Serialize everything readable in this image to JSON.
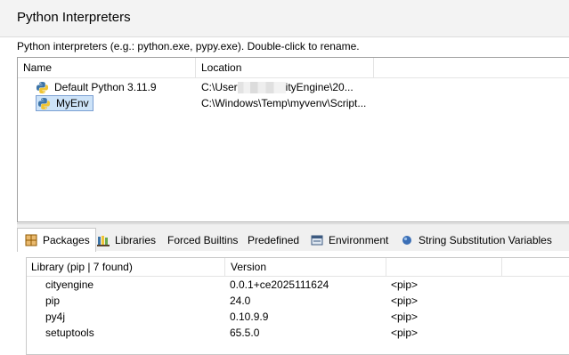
{
  "header": {
    "title": "Python Interpreters",
    "description": "Python interpreters (e.g.: python.exe, pypy.exe).   Double-click to rename."
  },
  "interpreters": {
    "columns": [
      "Name",
      "Location"
    ],
    "rows": [
      {
        "name": "Default Python 3.11.9",
        "location_prefix": "C:\\User",
        "location_suffix": "ityEngine\\20...",
        "icon": "python-icon",
        "selected": false
      },
      {
        "name": "MyEnv",
        "location": "C:\\Windows\\Temp\\myvenv\\Script...",
        "icon": "python-icon",
        "selected": true
      }
    ]
  },
  "tabs": [
    {
      "label": "Packages",
      "icon": "packages-icon",
      "active": true
    },
    {
      "label": "Libraries",
      "icon": "libraries-icon",
      "active": false
    },
    {
      "label": "Forced Builtins",
      "active": false
    },
    {
      "label": "Predefined",
      "active": false
    },
    {
      "label": "Environment",
      "icon": "environment-icon",
      "active": false
    },
    {
      "label": "String Substitution Variables",
      "icon": "variables-icon",
      "active": false
    }
  ],
  "packages": {
    "columns": [
      "Library (pip | 7 found)",
      "Version"
    ],
    "rows": [
      {
        "library": "cityengine",
        "version": "0.0.1+ce2025111624",
        "source": "<pip>"
      },
      {
        "library": "pip",
        "version": "24.0",
        "source": "<pip>"
      },
      {
        "library": "py4j",
        "version": "0.10.9.9",
        "source": "<pip>"
      },
      {
        "library": "setuptools",
        "version": "65.5.0",
        "source": "<pip>"
      }
    ]
  },
  "colors": {
    "selection": "#cde3f8",
    "selection_border": "#7a9fd3",
    "python_blue": "#3d74a7",
    "python_yellow": "#f0c534"
  }
}
